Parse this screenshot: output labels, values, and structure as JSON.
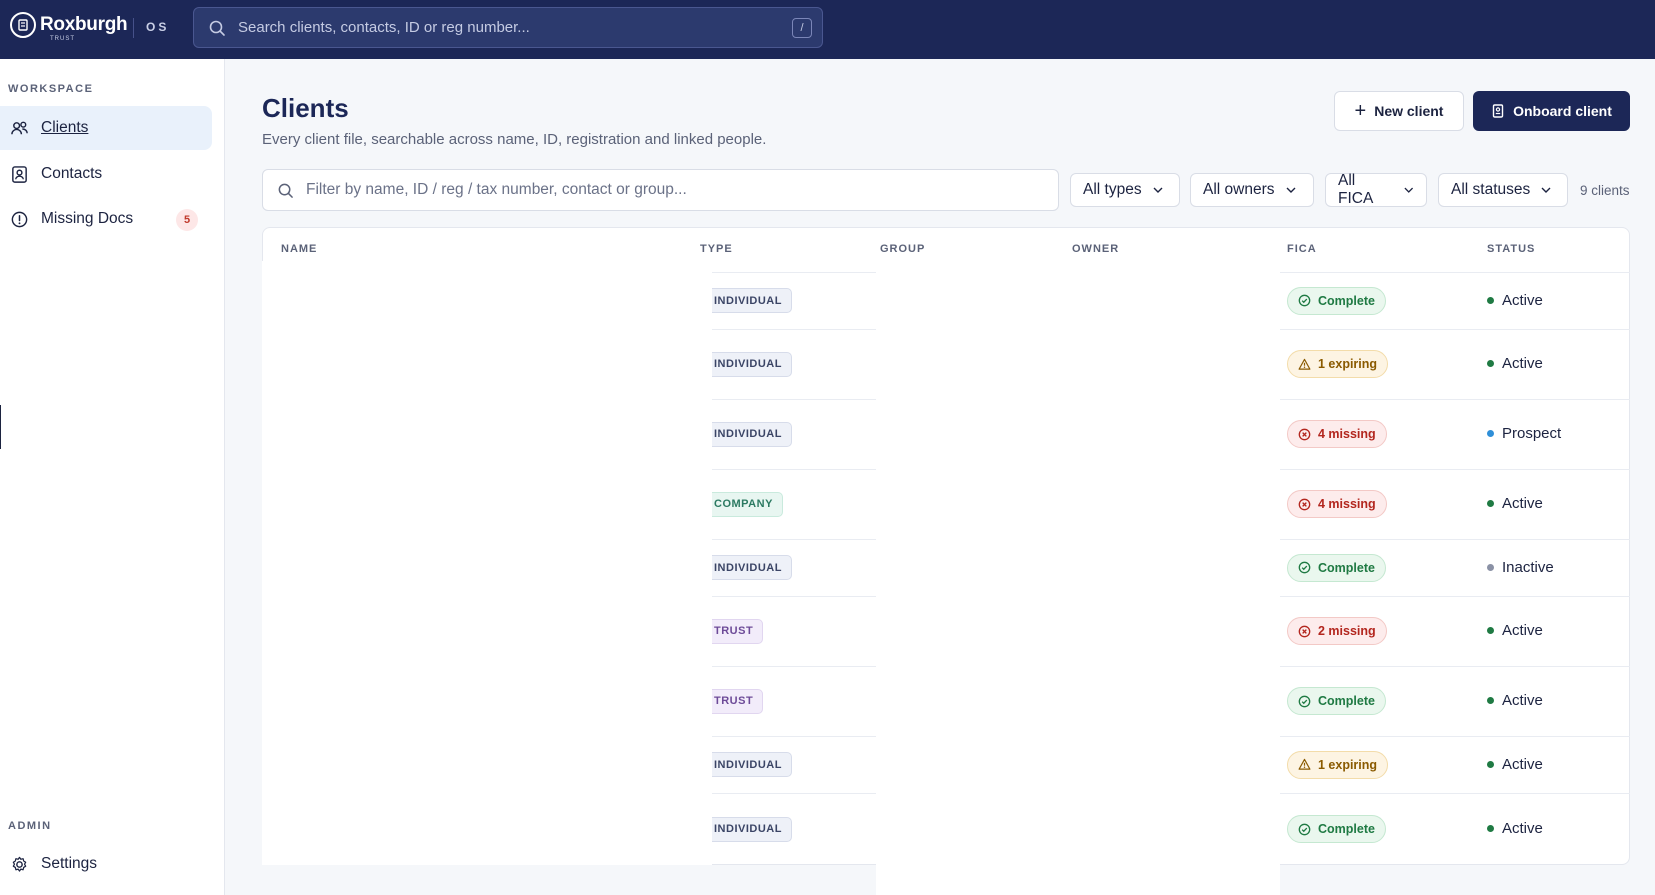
{
  "brand": {
    "name": "Roxburgh",
    "sub": "TRUST",
    "os": "OS"
  },
  "global_search": {
    "placeholder": "Search clients, contacts, ID or reg number...",
    "shortcut": "/"
  },
  "sidebar": {
    "workspace_label": "WORKSPACE",
    "items": [
      {
        "label": "Clients",
        "icon": "users-icon",
        "active": true
      },
      {
        "label": "Contacts",
        "icon": "contact-book-icon",
        "active": false
      },
      {
        "label": "Missing Docs",
        "icon": "alert-circle-icon",
        "active": false,
        "badge": "5"
      }
    ],
    "admin_label": "ADMIN",
    "admin_items": [
      {
        "label": "Settings",
        "icon": "gear-icon"
      }
    ]
  },
  "page": {
    "title": "Clients",
    "subtitle": "Every client file, searchable across name, ID, registration and linked people.",
    "new_client": "New client",
    "onboard_client": "Onboard client"
  },
  "filters": {
    "placeholder": "Filter by name, ID / reg / tax number, contact or group...",
    "types": "All types",
    "owners": "All owners",
    "fica": "All FICA",
    "statuses": "All statuses",
    "count": "9 clients"
  },
  "table": {
    "columns": {
      "name": "NAME",
      "type": "TYPE",
      "group": "GROUP",
      "owner": "OWNER",
      "fica": "FICA",
      "status": "STATUS"
    },
    "rows": [
      {
        "type": "INDIVIDUAL",
        "type_kind": "individual",
        "fica": "Complete",
        "fica_kind": "complete",
        "status": "Active",
        "status_kind": "active"
      },
      {
        "type": "INDIVIDUAL",
        "type_kind": "individual",
        "fica": "1 expiring",
        "fica_kind": "expiring",
        "status": "Active",
        "status_kind": "active"
      },
      {
        "type": "INDIVIDUAL",
        "type_kind": "individual",
        "fica": "4 missing",
        "fica_kind": "missing",
        "status": "Prospect",
        "status_kind": "prospect"
      },
      {
        "type": "COMPANY",
        "type_kind": "company",
        "fica": "4 missing",
        "fica_kind": "missing",
        "status": "Active",
        "status_kind": "active"
      },
      {
        "type": "INDIVIDUAL",
        "type_kind": "individual",
        "fica": "Complete",
        "fica_kind": "complete",
        "status": "Inactive",
        "status_kind": "inactive"
      },
      {
        "type": "TRUST",
        "type_kind": "trust",
        "fica": "2 missing",
        "fica_kind": "missing",
        "status": "Active",
        "status_kind": "active"
      },
      {
        "type": "TRUST",
        "type_kind": "trust",
        "fica": "Complete",
        "fica_kind": "complete",
        "status": "Active",
        "status_kind": "active"
      },
      {
        "type": "INDIVIDUAL",
        "type_kind": "individual",
        "fica": "1 expiring",
        "fica_kind": "expiring",
        "status": "Active",
        "status_kind": "active"
      },
      {
        "type": "INDIVIDUAL",
        "type_kind": "individual",
        "fica": "Complete",
        "fica_kind": "complete",
        "status": "Active",
        "status_kind": "active"
      }
    ]
  },
  "colors": {
    "navy": "#1c2757",
    "active_dot": "#1f7a43",
    "prospect_dot": "#2f8fd8",
    "inactive_dot": "#8a91a5"
  }
}
